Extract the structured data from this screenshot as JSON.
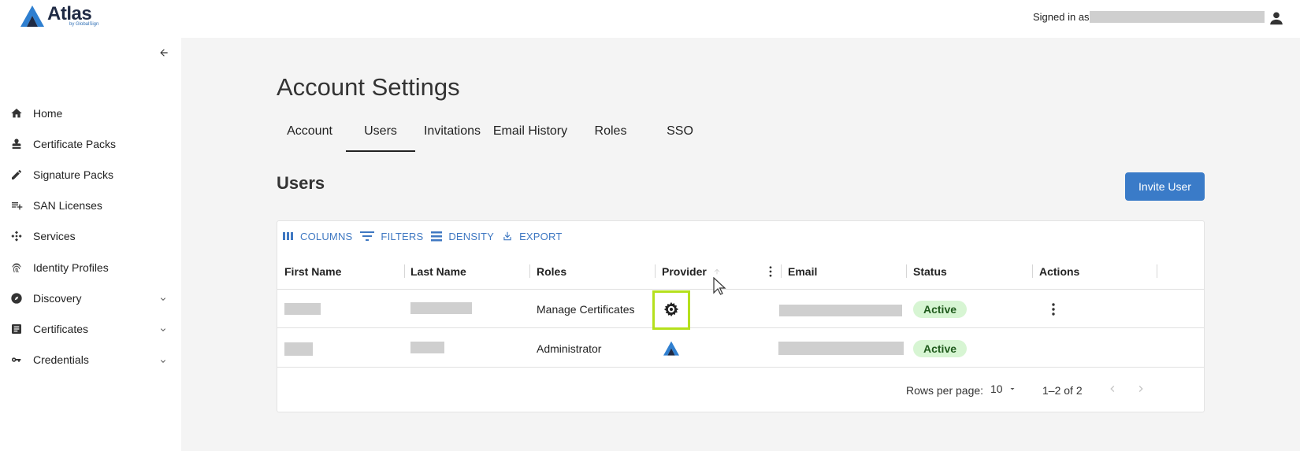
{
  "app": {
    "logo_text": "Atlas",
    "logo_sub": "by GlobalSign",
    "signed_in_label": "Signed in as"
  },
  "sidebar": {
    "items": [
      {
        "label": "Home",
        "icon": "home-icon"
      },
      {
        "label": "Certificate Packs",
        "icon": "stamp-icon"
      },
      {
        "label": "Signature Packs",
        "icon": "pencil-icon"
      },
      {
        "label": "SAN Licenses",
        "icon": "playlist-add-icon"
      },
      {
        "label": "Services",
        "icon": "services-icon"
      },
      {
        "label": "Identity Profiles",
        "icon": "fingerprint-icon"
      },
      {
        "label": "Discovery",
        "icon": "compass-icon",
        "expandable": true
      },
      {
        "label": "Certificates",
        "icon": "document-icon",
        "expandable": true
      },
      {
        "label": "Credentials",
        "icon": "key-icon",
        "expandable": true
      }
    ]
  },
  "page": {
    "title": "Account Settings",
    "tabs": [
      {
        "label": "Account"
      },
      {
        "label": "Users",
        "active": true
      },
      {
        "label": "Invitations"
      },
      {
        "label": "Email History"
      },
      {
        "label": "Roles"
      },
      {
        "label": "SSO"
      }
    ],
    "section_title": "Users",
    "invite_button": "Invite User"
  },
  "grid": {
    "toolbar": {
      "columns": "COLUMNS",
      "filters": "FILTERS",
      "density": "DENSITY",
      "export": "EXPORT"
    },
    "columns": [
      "First Name",
      "Last Name",
      "Roles",
      "Provider",
      "Email",
      "Status",
      "Actions"
    ],
    "rows": [
      {
        "role": "Manage Certificates",
        "provider": "sso-gear-icon",
        "status": "Active"
      },
      {
        "role": "Administrator",
        "provider": "atlas-logo-icon",
        "status": "Active"
      }
    ],
    "footer": {
      "rows_per_page_label": "Rows per page:",
      "rows_per_page_value": "10",
      "range": "1–2 of 2"
    }
  },
  "colors": {
    "accent": "#3a7bc8",
    "highlight": "#b5e01c",
    "status_bg": "#d7f5d3",
    "main_bg": "#f4f4f4"
  }
}
